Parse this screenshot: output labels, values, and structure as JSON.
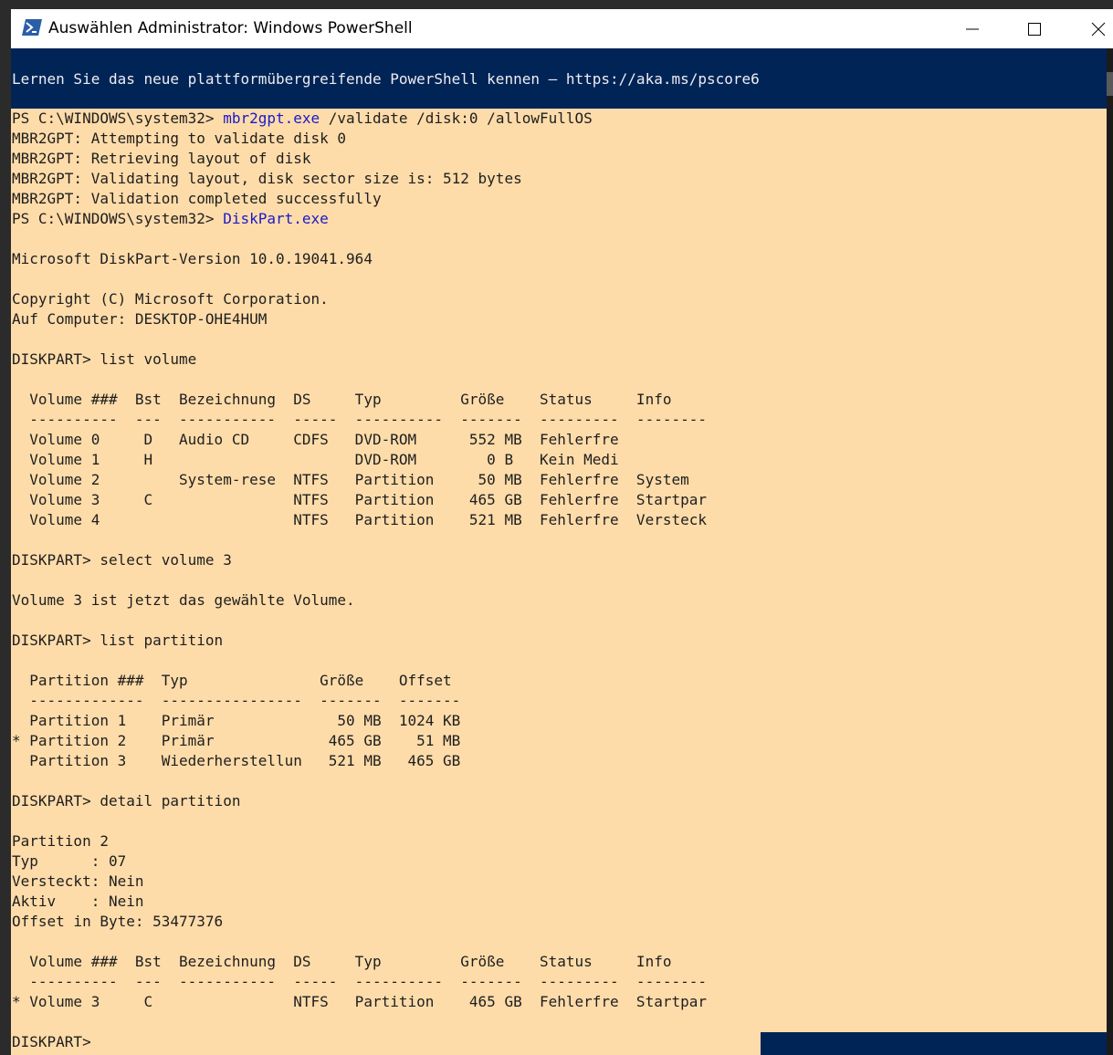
{
  "window": {
    "title": "Auswählen Administrator: Windows PowerShell",
    "icon": "powershell-icon",
    "controls": [
      "minimize-icon",
      "maximize-icon",
      "close-icon"
    ]
  },
  "colors": {
    "console_bg": "#012456",
    "buffer_bg": "#fedcaa",
    "command_text": "#1a1ac8",
    "output_text": "#1e1e1e"
  },
  "banner": "Lernen Sie das neue plattformübergreifende PowerShell kennen – https://aka.ms/pscore6",
  "lines": [
    {
      "pre": "PS C:\\WINDOWS\\system32> ",
      "cmd": "mbr2gpt.exe",
      "post": " /validate /disk:0 /allowFullOS"
    },
    {
      "pre": "MBR2GPT: Attempting to validate disk 0"
    },
    {
      "pre": "MBR2GPT: Retrieving layout of disk"
    },
    {
      "pre": "MBR2GPT: Validating layout, disk sector size is: 512 bytes"
    },
    {
      "pre": "MBR2GPT: Validation completed successfully"
    },
    {
      "pre": "PS C:\\WINDOWS\\system32> ",
      "cmd": "DiskPart.exe"
    },
    {
      "pre": ""
    },
    {
      "pre": "Microsoft DiskPart-Version 10.0.19041.964"
    },
    {
      "pre": ""
    },
    {
      "pre": "Copyright (C) Microsoft Corporation."
    },
    {
      "pre": "Auf Computer: DESKTOP-OHE4HUM"
    },
    {
      "pre": ""
    },
    {
      "pre": "DISKPART> list volume"
    },
    {
      "pre": ""
    },
    {
      "pre": "  Volume ###  Bst  Bezeichnung  DS     Typ         Größe    Status     Info"
    },
    {
      "pre": "  ----------  ---  -----------  -----  ----------  -------  ---------  --------"
    },
    {
      "pre": "  Volume 0     D   Audio CD     CDFS   DVD-ROM      552 MB  Fehlerfre"
    },
    {
      "pre": "  Volume 1     H                       DVD-ROM        0 B   Kein Medi"
    },
    {
      "pre": "  Volume 2         System-rese  NTFS   Partition     50 MB  Fehlerfre  System"
    },
    {
      "pre": "  Volume 3     C                NTFS   Partition    465 GB  Fehlerfre  Startpar"
    },
    {
      "pre": "  Volume 4                      NTFS   Partition    521 MB  Fehlerfre  Versteck"
    },
    {
      "pre": ""
    },
    {
      "pre": "DISKPART> select volume 3"
    },
    {
      "pre": ""
    },
    {
      "pre": "Volume 3 ist jetzt das gewählte Volume."
    },
    {
      "pre": ""
    },
    {
      "pre": "DISKPART> list partition"
    },
    {
      "pre": ""
    },
    {
      "pre": "  Partition ###  Typ               Größe    Offset"
    },
    {
      "pre": "  -------------  ----------------  -------  -------"
    },
    {
      "pre": "  Partition 1    Primär              50 MB  1024 KB"
    },
    {
      "pre": "* Partition 2    Primär             465 GB    51 MB"
    },
    {
      "pre": "  Partition 3    Wiederherstellun   521 MB   465 GB"
    },
    {
      "pre": ""
    },
    {
      "pre": "DISKPART> detail partition"
    },
    {
      "pre": ""
    },
    {
      "pre": "Partition 2"
    },
    {
      "pre": "Typ      : 07"
    },
    {
      "pre": "Versteckt: Nein"
    },
    {
      "pre": "Aktiv    : Nein"
    },
    {
      "pre": "Offset in Byte: 53477376"
    },
    {
      "pre": ""
    },
    {
      "pre": "  Volume ###  Bst  Bezeichnung  DS     Typ         Größe    Status     Info"
    },
    {
      "pre": "  ----------  ---  -----------  -----  ----------  -------  ---------  --------"
    },
    {
      "pre": "* Volume 3     C                NTFS   Partition    465 GB  Fehlerfre  Startpar"
    },
    {
      "pre": ""
    },
    {
      "pre": "DISKPART> "
    }
  ]
}
